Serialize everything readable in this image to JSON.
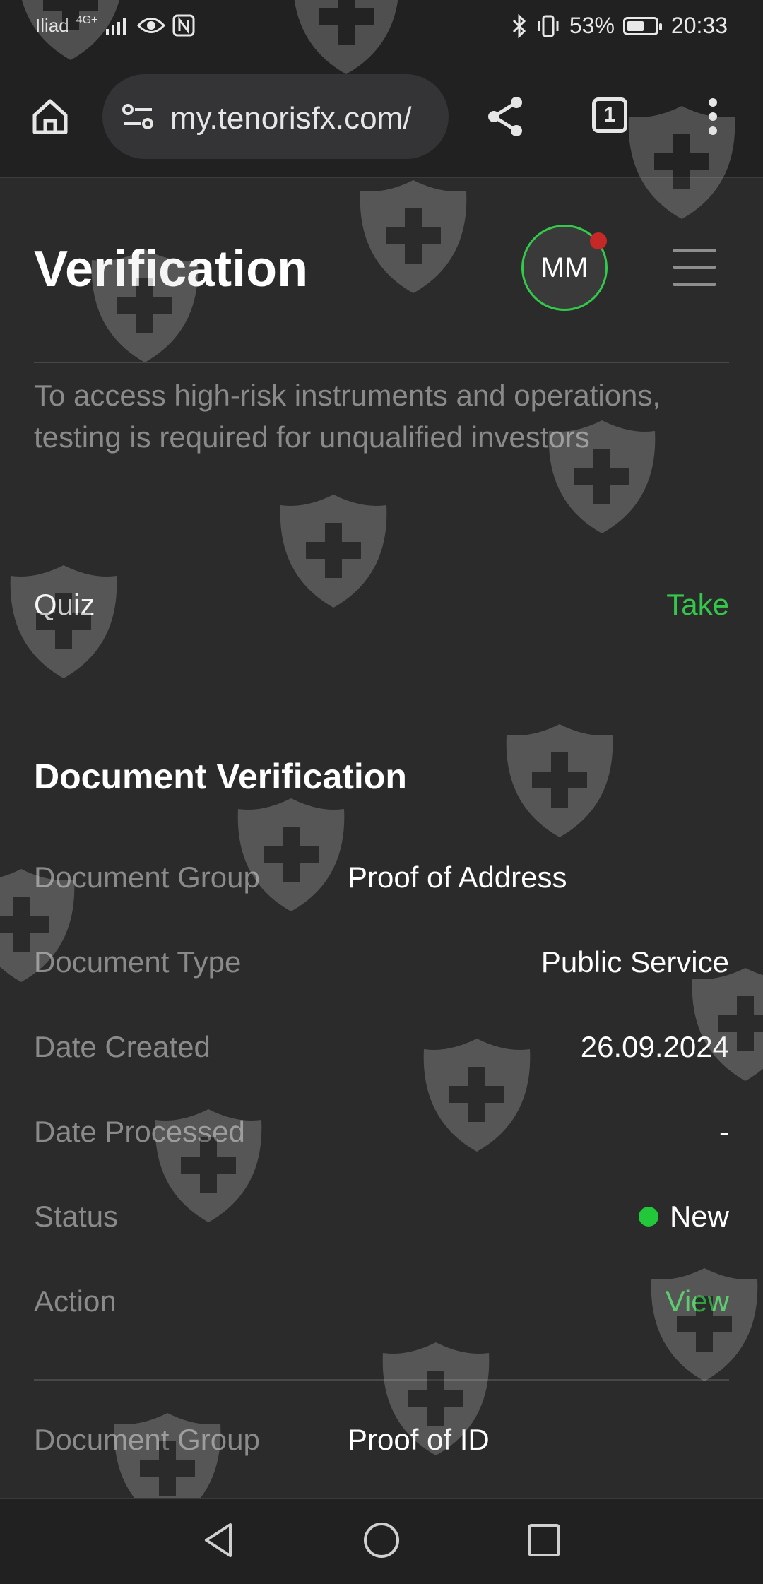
{
  "status_bar": {
    "carrier": "Iliad",
    "network": "4G+",
    "battery": "53%",
    "time": "20:33"
  },
  "browser": {
    "url": "my.tenorisfx.com/",
    "tab_count": "1"
  },
  "page": {
    "title": "Verification",
    "avatar_initials": "MM",
    "description": "To access high-risk instruments and operations, testing is required for unqualified investors"
  },
  "quiz": {
    "label": "Quiz",
    "action": "Take"
  },
  "documents": {
    "section_title": "Document Verification",
    "labels": {
      "group": "Document Group",
      "type": "Document Type",
      "created": "Date Created",
      "processed": "Date Processed",
      "status": "Status",
      "action": "Action"
    },
    "items": [
      {
        "group": "Proof of Address",
        "type": "Public Service",
        "created": "26.09.2024",
        "processed": "-",
        "status": "New",
        "action": "View"
      },
      {
        "group": "Proof of ID"
      }
    ]
  },
  "colors": {
    "accent_green": "#34c84a",
    "status_new": "#22c83a",
    "notification_dot": "#c62828",
    "background": "#2b2b2c"
  },
  "icons": {
    "home": "home-icon",
    "site_settings": "tune-icon",
    "share": "share-icon",
    "tabs": "tab-switcher-icon",
    "overflow": "more-vert-icon",
    "menu": "hamburger-menu-icon",
    "back": "nav-back-icon",
    "home_nav": "nav-home-icon",
    "recents": "nav-recents-icon",
    "watermark": "shield-cross-icon"
  }
}
